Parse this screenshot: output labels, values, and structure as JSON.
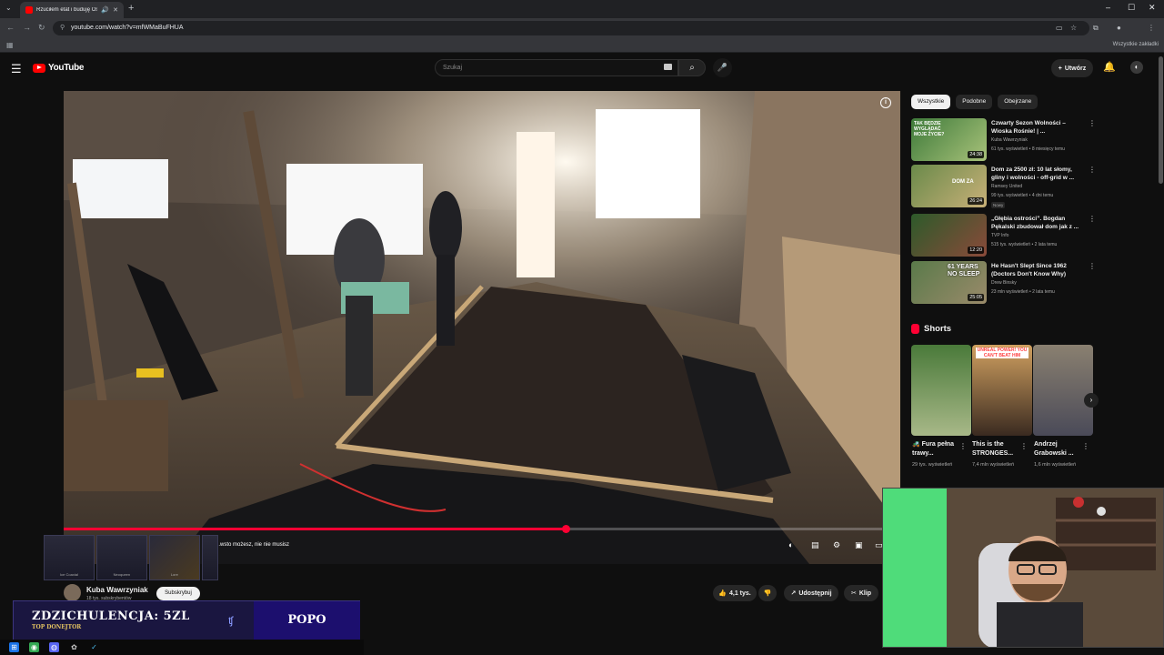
{
  "browser": {
    "tab_title": "Rzuciłem etat i buduję Osa",
    "url": "youtube.com/watch?v=mfWMaBuFHUA",
    "bookmarks_label": "Wszystkie zakładki"
  },
  "header": {
    "logo_text": "YouTube",
    "search_placeholder": "Szukaj",
    "create_label": "Utwórz"
  },
  "player": {
    "progress_fraction": 0.6,
    "chapter_text": "...wsto możesz, nie nie musisz"
  },
  "sponsor": {
    "items": [
      "Ice Coaxial",
      "Neoqueen",
      "Lore",
      ""
    ]
  },
  "channel": {
    "name": "Kuba Wawrzyniak",
    "subs": "18 tys. subskrybentów",
    "subscribe_label": "Subskrybuj"
  },
  "actions": {
    "likes": "4,1 tys.",
    "share": "Udostępnij",
    "clip": "Klip"
  },
  "donation": {
    "title": "ZDZICHULENCJA: 5ZL",
    "subtitle": "TOP DONEJTOR",
    "donor": "POPO"
  },
  "sidebar": {
    "chips": [
      "Wszystkie",
      "Podobne",
      "Obejrzane"
    ],
    "recommendations": [
      {
        "title": "Czwarty Sezon Wolności – Wioska Rośnie! | ...",
        "channel": "Kuba Wawrzyniak",
        "meta": "61 tys. wyświetleń • 8 miesięcy temu",
        "duration": "24:38",
        "thumb_text": "TAK BĘDZIE WYGLĄDAĆ MOJE ŻYCIE?",
        "badge": ""
      },
      {
        "title": "Dom za 2500 zł: 10 lat słomy, gliny i wolności - off-grid w ...",
        "channel": "Ramsey United",
        "meta": "99 tys. wyświetleń • 4 dni temu",
        "duration": "26:24",
        "thumb_text": "DOM ZA",
        "badge": "Nowy"
      },
      {
        "title": "„Głębia ostrości”. Bogdan Pękalski zbudował dom jak z ...",
        "channel": "TVP Info",
        "meta": "515 tys. wyświetleń • 2 lata temu",
        "duration": "12:20",
        "thumb_text": "",
        "badge": ""
      },
      {
        "title": "He Hasn't Slept Since 1962 (Doctors Don't Know Why)",
        "channel": "Drew Binsky",
        "meta": "23 mln wyświetleń • 2 lata temu",
        "duration": "25:05",
        "thumb_text": "61 YEARS NO SLEEP",
        "badge": ""
      }
    ],
    "shorts_label": "Shorts",
    "shorts": [
      {
        "title": "🚜 Fura pełna trawy...",
        "views": "29 tys. wyświetleń",
        "thumb_text": ""
      },
      {
        "title": "This is the STRONGES...",
        "views": "7,4 mln wyświetleń",
        "thumb_text": "UNREAL POWER! YOU CAN'T BEAT HIM"
      },
      {
        "title": "Andrzej Grabowski ...",
        "views": "1,6 mln wyświetleń",
        "thumb_text": ""
      }
    ]
  }
}
